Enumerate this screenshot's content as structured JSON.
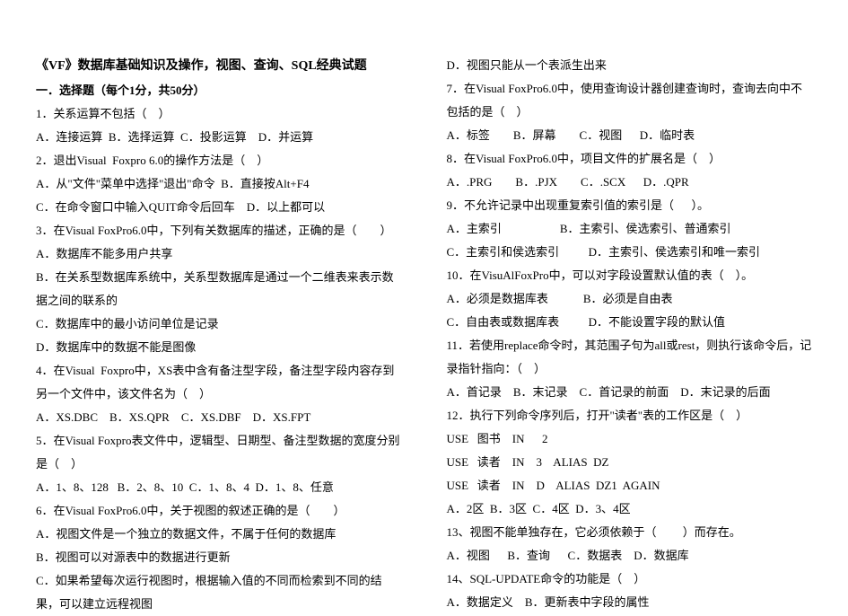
{
  "title": "《VF》数据库基础知识及操作，视图、查询、SQL经典试题",
  "section1_heading": "一．选择题（每个1分，共50分）",
  "left": [
    "1．关系运算不包括（    ）",
    "A．连接运算  B．选择运算  C．投影运算    D．并运算",
    "2．退出Visual  Foxpro 6.0的操作方法是（    ）",
    "A．从\"文件\"菜单中选择\"退出\"命令  B．直接按Alt+F4",
    "C．在命令窗口中输入QUIT命令后回车    D．以上都可以",
    "3．在Visual FoxPro6.0中，下列有关数据库的描述，正确的是（        ）",
    "A．数据库不能多用户共享",
    "B．在关系型数据库系统中，关系型数据库是通过一个二维表来表示数据之间的联系的",
    "C．数据库中的最小访问单位是记录",
    "D．数据库中的数据不能是图像",
    "4．在Visual  Foxpro中，XS表中含有备注型字段，备注型字段内容存到另一个文件中，该文件名为（    ）",
    "A．XS.DBC    B．XS.QPR    C．XS.DBF    D．XS.FPT",
    "5．在Visual Foxpro表文件中，逻辑型、日期型、备注型数据的宽度分别是（    ）",
    "A．1、8、128   B．2、8、10  C．1、8、4  D．1、8、任意",
    "6．在Visual FoxPro6.0中，关于视图的叙述正确的是（        ）",
    "A．视图文件是一个独立的数据文件，不属于任何的数据库",
    "B．视图可以对源表中的数据进行更新",
    "C．如果希望每次运行视图时，根据输入值的不同而检索到不同的结果，可以建立远程视图"
  ],
  "right": [
    "D．视图只能从一个表派生出来",
    "7．在Visual FoxPro6.0中，使用查询设计器创建查询时，查询去向中不包括的是（    ）",
    "A．标签        B．屏幕        C．视图      D．临时表",
    "8．在Visual FoxPro6.0中，项目文件的扩展名是（    ）",
    "A．.PRG        B．.PJX        C．.SCX      D．.QPR",
    "9．不允许记录中出现重复索引值的索引是（      ）。",
    "A．主索引                    B．主索引、侯选索引、普通索引",
    "C．主索引和侯选索引          D．主索引、侯选索引和唯一索引",
    "10．在VisuAlFoxPro中，可以对字段设置默认值的表（    ）。",
    "A．必须是数据库表            B．必须是自由表",
    "C．自由表或数据库表          D．不能设置字段的默认值",
    "11．若使用replace命令时，其范围子句为all或rest，则执行该命令后，记录指针指向：（    ）",
    "A．首记录    B．末记录    C．首记录的前面    D．末记录的后面",
    "12．执行下列命令序列后，打开\"读者\"表的工作区是（    ）",
    "USE   图书    IN      2",
    "USE   读者    IN    3    ALIAS  DZ",
    "USE   读者    IN    D    ALIAS  DZ1  AGAIN",
    "A．2区  B．3区  C．4区  D．3、4区",
    "13、视图不能单独存在，它必须依赖于（         ）而存在。",
    "A．视图      B．查询      C．数据表    D．数据库",
    "14、SQL-UPDATE命令的功能是（    ）",
    "A．数据定义    B．更新表中字段的属性"
  ]
}
